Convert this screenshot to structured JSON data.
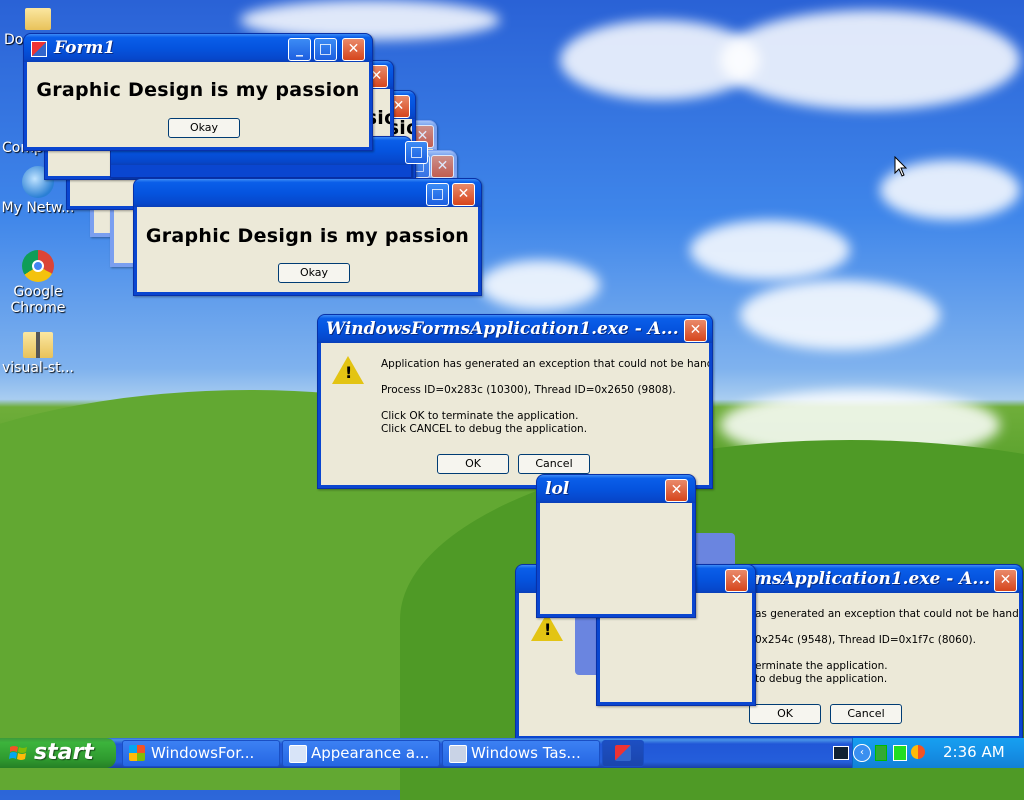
{
  "desktop": {
    "icons": [
      {
        "label": "Do",
        "name": "documents"
      },
      {
        "label": "Comp",
        "name": "computer"
      },
      {
        "label": "My Netw...",
        "name": "network"
      },
      {
        "label": "Google Chrome",
        "name": "chrome"
      },
      {
        "label": "visual-st...",
        "name": "visual-studio"
      }
    ]
  },
  "form1": {
    "title": "Form1",
    "passion": "Graphic Design is my passion",
    "okay": "Okay"
  },
  "stack_window": {
    "passion": "Graphic Design is my passion",
    "okay": "Okay"
  },
  "error1": {
    "title": "WindowsFormsApplication1.exe - A...",
    "line1": "Application has generated an exception that could not be handled.",
    "line2": "Process ID=0x283c (10300), Thread ID=0x2650 (9808).",
    "line3": "Click OK to terminate the application.",
    "line4": "Click CANCEL to debug the application.",
    "ok": "OK",
    "cancel": "Cancel"
  },
  "error2": {
    "title": "msApplication1.exe - A...",
    "line1": "as generated an exception that could not be handled.",
    "line2": "0x254c (9548), Thread ID=0x1f7c (8060).",
    "line3": "erminate the application.",
    "line4": "to debug the application.",
    "ok": "OK",
    "cancel": "Cancel"
  },
  "lol": {
    "title": "lol"
  },
  "taskbar": {
    "start": "start",
    "items": [
      {
        "label": "WindowsFor..."
      },
      {
        "label": "Appearance a..."
      },
      {
        "label": "Windows Tas..."
      }
    ],
    "clock": "2:36 AM"
  },
  "colors": {
    "titlebar": "#0554df",
    "client": "#ece9d8",
    "close_button": "#d6451c",
    "start_button": "#3cb43c",
    "taskbar": "#245edb",
    "tray": "#1590e6"
  }
}
